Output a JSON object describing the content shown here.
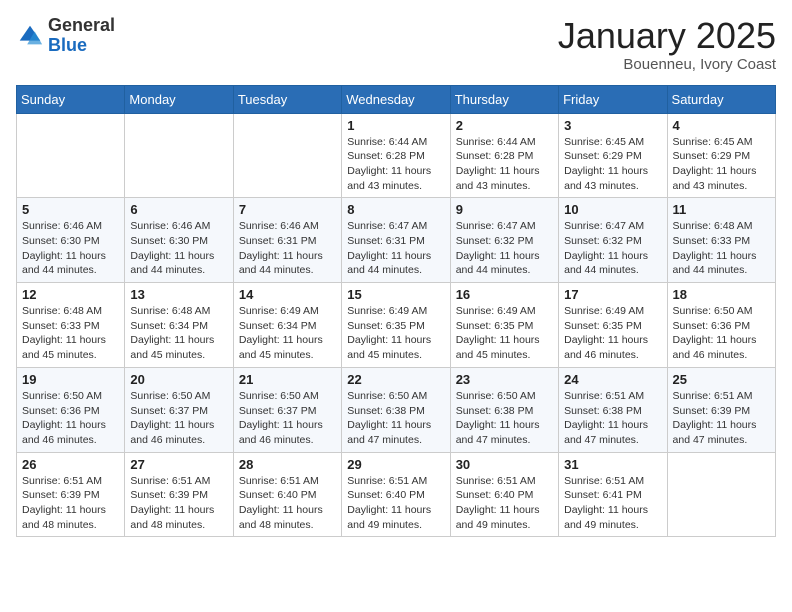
{
  "header": {
    "logo_general": "General",
    "logo_blue": "Blue",
    "month_title": "January 2025",
    "subtitle": "Bouenneu, Ivory Coast"
  },
  "weekdays": [
    "Sunday",
    "Monday",
    "Tuesday",
    "Wednesday",
    "Thursday",
    "Friday",
    "Saturday"
  ],
  "weeks": [
    [
      {
        "day": "",
        "info": ""
      },
      {
        "day": "",
        "info": ""
      },
      {
        "day": "",
        "info": ""
      },
      {
        "day": "1",
        "info": "Sunrise: 6:44 AM\nSunset: 6:28 PM\nDaylight: 11 hours\nand 43 minutes."
      },
      {
        "day": "2",
        "info": "Sunrise: 6:44 AM\nSunset: 6:28 PM\nDaylight: 11 hours\nand 43 minutes."
      },
      {
        "day": "3",
        "info": "Sunrise: 6:45 AM\nSunset: 6:29 PM\nDaylight: 11 hours\nand 43 minutes."
      },
      {
        "day": "4",
        "info": "Sunrise: 6:45 AM\nSunset: 6:29 PM\nDaylight: 11 hours\nand 43 minutes."
      }
    ],
    [
      {
        "day": "5",
        "info": "Sunrise: 6:46 AM\nSunset: 6:30 PM\nDaylight: 11 hours\nand 44 minutes."
      },
      {
        "day": "6",
        "info": "Sunrise: 6:46 AM\nSunset: 6:30 PM\nDaylight: 11 hours\nand 44 minutes."
      },
      {
        "day": "7",
        "info": "Sunrise: 6:46 AM\nSunset: 6:31 PM\nDaylight: 11 hours\nand 44 minutes."
      },
      {
        "day": "8",
        "info": "Sunrise: 6:47 AM\nSunset: 6:31 PM\nDaylight: 11 hours\nand 44 minutes."
      },
      {
        "day": "9",
        "info": "Sunrise: 6:47 AM\nSunset: 6:32 PM\nDaylight: 11 hours\nand 44 minutes."
      },
      {
        "day": "10",
        "info": "Sunrise: 6:47 AM\nSunset: 6:32 PM\nDaylight: 11 hours\nand 44 minutes."
      },
      {
        "day": "11",
        "info": "Sunrise: 6:48 AM\nSunset: 6:33 PM\nDaylight: 11 hours\nand 44 minutes."
      }
    ],
    [
      {
        "day": "12",
        "info": "Sunrise: 6:48 AM\nSunset: 6:33 PM\nDaylight: 11 hours\nand 45 minutes."
      },
      {
        "day": "13",
        "info": "Sunrise: 6:48 AM\nSunset: 6:34 PM\nDaylight: 11 hours\nand 45 minutes."
      },
      {
        "day": "14",
        "info": "Sunrise: 6:49 AM\nSunset: 6:34 PM\nDaylight: 11 hours\nand 45 minutes."
      },
      {
        "day": "15",
        "info": "Sunrise: 6:49 AM\nSunset: 6:35 PM\nDaylight: 11 hours\nand 45 minutes."
      },
      {
        "day": "16",
        "info": "Sunrise: 6:49 AM\nSunset: 6:35 PM\nDaylight: 11 hours\nand 45 minutes."
      },
      {
        "day": "17",
        "info": "Sunrise: 6:49 AM\nSunset: 6:35 PM\nDaylight: 11 hours\nand 46 minutes."
      },
      {
        "day": "18",
        "info": "Sunrise: 6:50 AM\nSunset: 6:36 PM\nDaylight: 11 hours\nand 46 minutes."
      }
    ],
    [
      {
        "day": "19",
        "info": "Sunrise: 6:50 AM\nSunset: 6:36 PM\nDaylight: 11 hours\nand 46 minutes."
      },
      {
        "day": "20",
        "info": "Sunrise: 6:50 AM\nSunset: 6:37 PM\nDaylight: 11 hours\nand 46 minutes."
      },
      {
        "day": "21",
        "info": "Sunrise: 6:50 AM\nSunset: 6:37 PM\nDaylight: 11 hours\nand 46 minutes."
      },
      {
        "day": "22",
        "info": "Sunrise: 6:50 AM\nSunset: 6:38 PM\nDaylight: 11 hours\nand 47 minutes."
      },
      {
        "day": "23",
        "info": "Sunrise: 6:50 AM\nSunset: 6:38 PM\nDaylight: 11 hours\nand 47 minutes."
      },
      {
        "day": "24",
        "info": "Sunrise: 6:51 AM\nSunset: 6:38 PM\nDaylight: 11 hours\nand 47 minutes."
      },
      {
        "day": "25",
        "info": "Sunrise: 6:51 AM\nSunset: 6:39 PM\nDaylight: 11 hours\nand 47 minutes."
      }
    ],
    [
      {
        "day": "26",
        "info": "Sunrise: 6:51 AM\nSunset: 6:39 PM\nDaylight: 11 hours\nand 48 minutes."
      },
      {
        "day": "27",
        "info": "Sunrise: 6:51 AM\nSunset: 6:39 PM\nDaylight: 11 hours\nand 48 minutes."
      },
      {
        "day": "28",
        "info": "Sunrise: 6:51 AM\nSunset: 6:40 PM\nDaylight: 11 hours\nand 48 minutes."
      },
      {
        "day": "29",
        "info": "Sunrise: 6:51 AM\nSunset: 6:40 PM\nDaylight: 11 hours\nand 49 minutes."
      },
      {
        "day": "30",
        "info": "Sunrise: 6:51 AM\nSunset: 6:40 PM\nDaylight: 11 hours\nand 49 minutes."
      },
      {
        "day": "31",
        "info": "Sunrise: 6:51 AM\nSunset: 6:41 PM\nDaylight: 11 hours\nand 49 minutes."
      },
      {
        "day": "",
        "info": ""
      }
    ]
  ]
}
